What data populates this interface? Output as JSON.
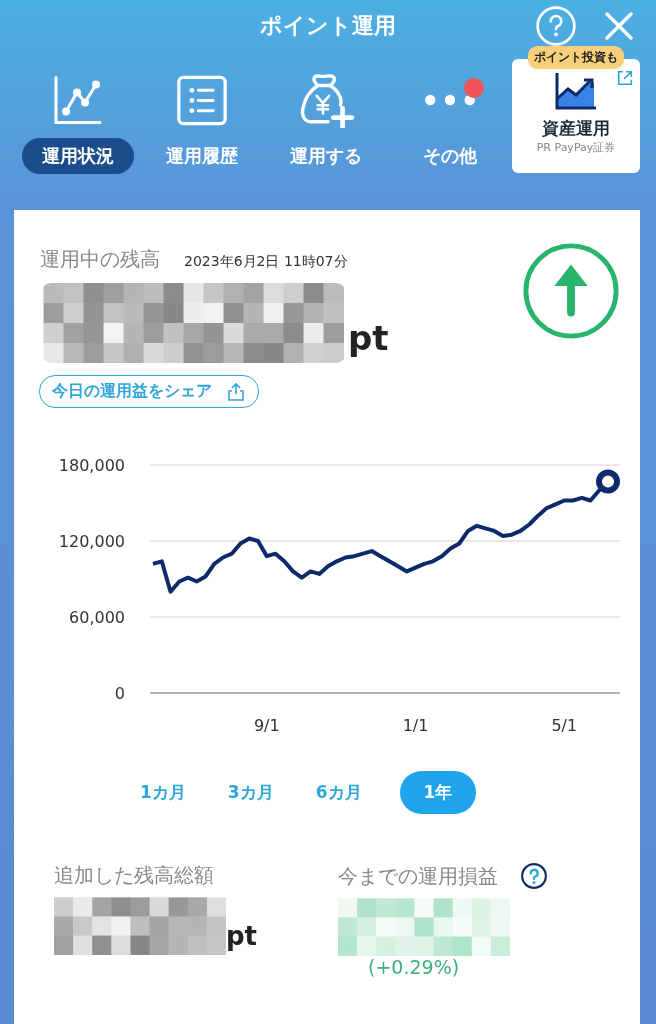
{
  "header": {
    "title": "ポイント運用"
  },
  "nav": [
    {
      "kind": "chart",
      "label": "運用状況",
      "selected": true,
      "notification": false
    },
    {
      "kind": "list",
      "label": "運用履歴",
      "selected": false,
      "notification": false
    },
    {
      "kind": "moneybag",
      "label": "運用する",
      "selected": false,
      "notification": false
    },
    {
      "kind": "more",
      "label": "その他",
      "selected": false,
      "notification": true
    }
  ],
  "promo": {
    "badge": "ポイント投資も",
    "title": "資産運用",
    "subtitle": "PR PayPay証券"
  },
  "balance": {
    "label": "運用中の残高",
    "timestamp": "2023年6月2日 11時07分",
    "masked": true,
    "unit": "pt",
    "share_button": "今日の運用益をシェア"
  },
  "chart_data": {
    "type": "line",
    "categories": [
      null,
      null,
      null,
      null,
      null,
      null,
      null,
      null,
      null,
      null,
      null,
      null,
      null,
      "9/1",
      null,
      null,
      null,
      null,
      null,
      null,
      null,
      null,
      null,
      null,
      null,
      null,
      null,
      null,
      null,
      null,
      "1/1",
      null,
      null,
      null,
      null,
      null,
      null,
      null,
      null,
      null,
      null,
      null,
      null,
      null,
      null,
      null,
      null,
      "5/1",
      null,
      null,
      null,
      null,
      null
    ],
    "series": [
      {
        "color": "#0d2a6b",
        "values": [
          102000,
          104000,
          80000,
          88000,
          91000,
          88000,
          92000,
          102000,
          107000,
          110000,
          118000,
          122000,
          120000,
          108000,
          110000,
          104000,
          96000,
          91000,
          96000,
          94000,
          100000,
          104000,
          107000,
          108000,
          110000,
          112000,
          108000,
          104000,
          100000,
          96000,
          99000,
          102000,
          104000,
          108000,
          114000,
          118000,
          128000,
          132000,
          130000,
          128000,
          124000,
          125000,
          128000,
          133000,
          140000,
          146000,
          149000,
          152000,
          152000,
          154000,
          152000,
          160000,
          167000
        ]
      }
    ],
    "ylim": [
      0,
      180000
    ],
    "yticks": [
      {
        "value": 0,
        "label": "0"
      },
      {
        "value": 60000,
        "label": "60,000"
      },
      {
        "value": 120000,
        "label": "120,000"
      },
      {
        "value": 180000,
        "label": "180,000"
      }
    ]
  },
  "ranges": [
    {
      "label": "1カ月",
      "selected": false
    },
    {
      "label": "3カ月",
      "selected": false
    },
    {
      "label": "6カ月",
      "selected": false
    },
    {
      "label": "1年",
      "selected": true
    }
  ],
  "summary": [
    {
      "label": "追加した残高総額",
      "masked": true,
      "unit": "pt",
      "help": false
    },
    {
      "label": "今までの運用損益",
      "masked": true,
      "percent": "(+0.29%)",
      "help": true
    }
  ]
}
